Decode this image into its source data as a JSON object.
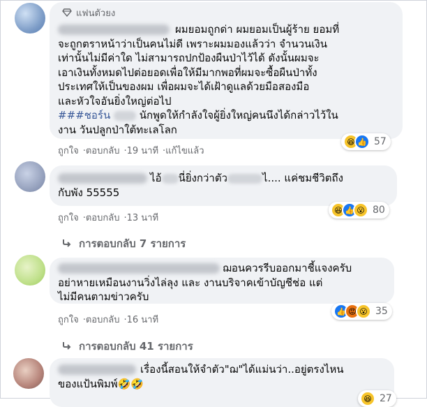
{
  "comments": [
    {
      "badge": "แฟนตัวยง",
      "lines": [
        "ผมยอมถูกด่า ผมยอมเป็นผู้ร้าย ยอมที่",
        "จะถูกตราหน้าว่าเป็นคนไม่ดี เพราะผมมองแล้วว่า จำนวนเงิน",
        "เท่านั้นไม่มีค่าใด ไม่สามารถปกป้องผืนป่าไว้ได้ ดังนั้นผมจะ",
        "เอาเงินทั้งหมดไปต่อยอดเพื่อให้มีมากพอที่ผมจะซื้อผืนป่าทั้ง",
        "ประเทศให้เป็นของผม เพื่อผมจะได้เฝ้าดูแลด้วยมือสองมือ",
        "และหัวใจอันยิ่งใหญ่ต่อไป"
      ],
      "hashtag": "###ชอร์น",
      "line7_rest": "นักพูดให้กำลังใจผู้ยิ่งใหญ่คนนึงได้กล่าวไว้ใน",
      "line8": "งาน วันปลูกป่าใต้ทะเลโลก",
      "actions": {
        "like": "ถูกใจ",
        "reply": "ตอบกลับ",
        "time": "19 นาที",
        "edited": "แก้ไขแล้ว"
      },
      "reaction_count": "57",
      "reactions": [
        "haha",
        "like"
      ]
    },
    {
      "part1": "ไอ้",
      "part2": "นี่ยิ่งกว่าตัว",
      "part3": "ไ.... แค่ชมชีวิตถึง",
      "line2": "กับพัง 55555",
      "actions": {
        "like": "ถูกใจ",
        "reply": "ตอบกลับ",
        "time": "13 นาที"
      },
      "reaction_count": "80",
      "reactions": [
        "haha",
        "like",
        "wow"
      ],
      "replies": "การตอบกลับ 7 รายการ"
    },
    {
      "line1": "ฌอนควรรีบออกมาชี้แจงครับ",
      "line2": "อย่าหายเหมือนงานวิ่งไล่ลุง และ งานบริจาคเข้าบัญชีช่อ แต่",
      "line3": "ไม่มีคนตามข่าวครับ",
      "actions": {
        "like": "ถูกใจ",
        "reply": "ตอบกลับ",
        "time": "16 นาที"
      },
      "reaction_count": "35",
      "reactions": [
        "like",
        "angry",
        "wow"
      ],
      "replies": "การตอบกลับ 41 รายการ"
    },
    {
      "line1": "เรื่องนี้สอนให้จำตัว\"ฌ\"ได้แม่นว่า..อยู่ตรงไหน",
      "line2": "ของแป้นพิมพ์🤣🤣",
      "reaction_count": "27"
    }
  ],
  "icons": {
    "badge": "diamond-icon",
    "reply_arrow": "reply-arrow-icon"
  },
  "colors": {
    "bubble": "#f0f2f5",
    "meta": "#65676b",
    "like": "#1877f2",
    "haha": "#f7c42a"
  }
}
